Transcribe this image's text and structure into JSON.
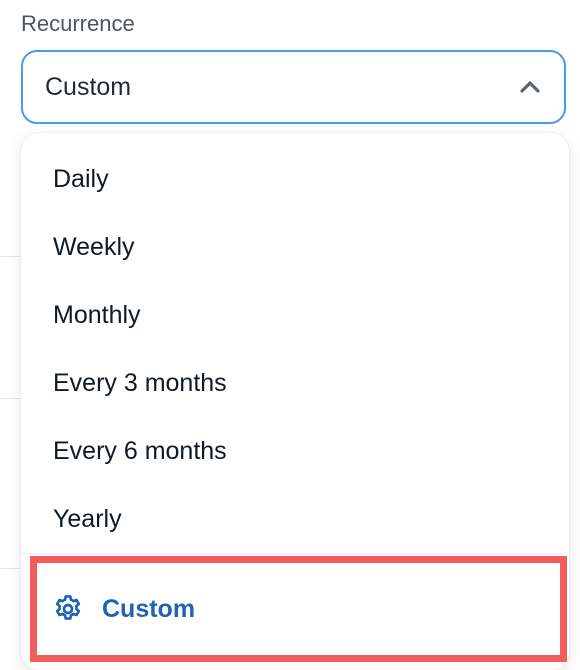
{
  "field": {
    "label": "Recurrence",
    "selected_value": "Custom",
    "expanded": true
  },
  "dropdown": {
    "options": [
      {
        "label": "Daily"
      },
      {
        "label": "Weekly"
      },
      {
        "label": "Monthly"
      },
      {
        "label": "Every 3 months"
      },
      {
        "label": "Every 6 months"
      },
      {
        "label": "Yearly"
      }
    ],
    "custom_option": {
      "label": "Custom",
      "icon": "gear-icon",
      "highlighted": true
    }
  },
  "colors": {
    "focus_border": "#4c9be8",
    "accent_blue": "#1f63b4",
    "highlight_border": "#f25c5c"
  }
}
